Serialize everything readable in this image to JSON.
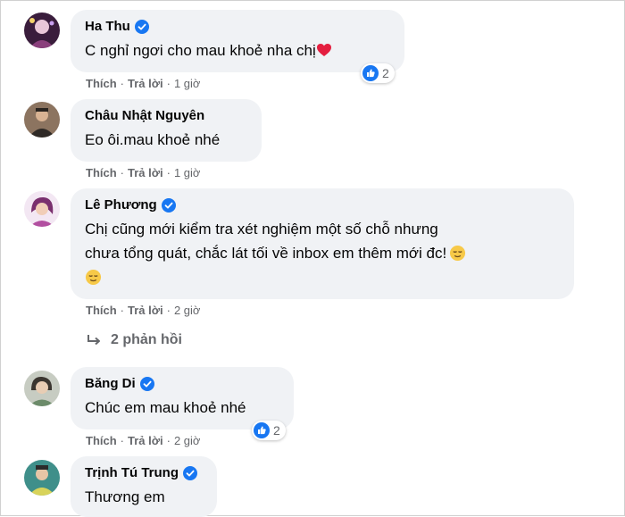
{
  "colors": {
    "verified": "#1877f2",
    "like": "#1877f2",
    "bubble": "#f0f2f5",
    "meta": "#65676b",
    "heart": "#e41e3f"
  },
  "actions": {
    "like": "Thích",
    "reply": "Trả lời",
    "separator": "·"
  },
  "comments": [
    {
      "name": "Ha Thu",
      "verified": true,
      "text": "C nghỉ ngơi cho mau khoẻ nha chị",
      "emoji": "red-heart",
      "time": "1 giờ",
      "reactions": "2"
    },
    {
      "name": "Châu Nhật Nguyên",
      "verified": false,
      "text": "Eo ôi.mau khoẻ nhé",
      "time": "1 giờ"
    },
    {
      "name": "Lê Phương",
      "verified": true,
      "text_line1": "Chị cũng mới kiểm tra xét nghiệm một số chỗ nhưng",
      "text_line2": "chưa tổng quát, chắc lát tối về inbox em thêm mới đc!",
      "emoji": "relieved-face",
      "time": "2 giờ",
      "replies": "2 phản hồi"
    },
    {
      "name": "Băng Di",
      "verified": true,
      "text": "Chúc em mau khoẻ nhé",
      "time": "2 giờ",
      "reactions": "2"
    },
    {
      "name": "Trịnh Tú Trung",
      "verified": true,
      "text": "Thương em"
    }
  ]
}
